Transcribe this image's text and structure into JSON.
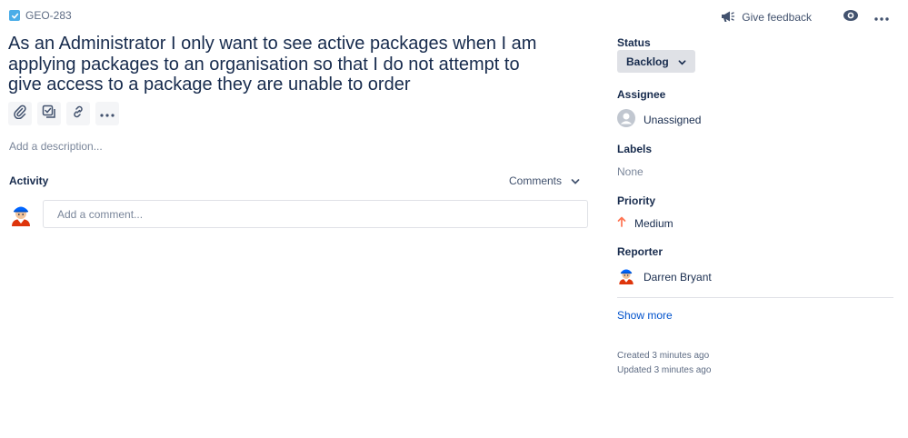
{
  "issue": {
    "key": "GEO-283",
    "summary": "As an Administrator I only want to see active packages when I am applying packages to an organisation so that I do not attempt to give access to a package they are unable to order",
    "description_placeholder": "Add a description..."
  },
  "topbar": {
    "feedback_label": "Give feedback",
    "icons": [
      "megaphone-icon",
      "eye-icon",
      "more-icon"
    ]
  },
  "toolbar": {
    "icons": [
      "attachment-icon",
      "subtask-icon",
      "link-icon",
      "more-icon"
    ]
  },
  "activity": {
    "label": "Activity",
    "filter_value": "Comments",
    "comment_placeholder": "Add a comment..."
  },
  "sidebar": {
    "status": {
      "label": "Status",
      "value": "Backlog"
    },
    "assignee": {
      "label": "Assignee",
      "value": "Unassigned"
    },
    "labels": {
      "label": "Labels",
      "value": "None"
    },
    "priority": {
      "label": "Priority",
      "value": "Medium",
      "color": "#ff7452"
    },
    "reporter": {
      "label": "Reporter",
      "value": "Darren Bryant"
    },
    "show_more": "Show more",
    "created": "Created 3 minutes ago",
    "updated": "Updated 3 minutes ago"
  },
  "colors": {
    "accent": "#0052cc",
    "task": "#4bade8"
  }
}
